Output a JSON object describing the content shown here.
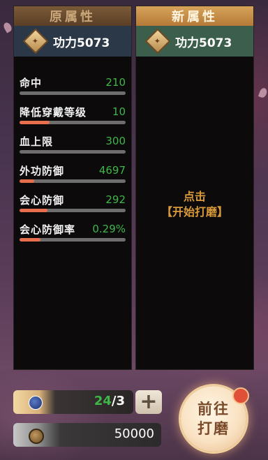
{
  "old_panel": {
    "tab_label": "原属性",
    "power_label": "功力5073",
    "stats": [
      {
        "label": "命中",
        "value": "210",
        "fill": 0.0
      },
      {
        "label": "降低穿戴等级",
        "value": "10",
        "fill": 0.28
      },
      {
        "label": "血上限",
        "value": "300",
        "fill": 0.0
      },
      {
        "label": "外功防御",
        "value": "4697",
        "fill": 0.14
      },
      {
        "label": "会心防御",
        "value": "292",
        "fill": 0.26
      },
      {
        "label": "会心防御率",
        "value": "0.29%",
        "fill": 0.2
      }
    ]
  },
  "new_panel": {
    "tab_label": "新属性",
    "power_label": "功力5073",
    "hint_line1": "点击",
    "hint_line2": "【开始打磨】"
  },
  "resources": {
    "count_current": "24",
    "count_sep": "/3",
    "coin_amount": "50000",
    "plus_label": "+"
  },
  "go_button": {
    "line1": "前往",
    "line2": "打磨"
  },
  "colors": {
    "stat_value": "#3fb648",
    "bar_fill": "#e86f4e",
    "hint": "#d99a3a"
  }
}
